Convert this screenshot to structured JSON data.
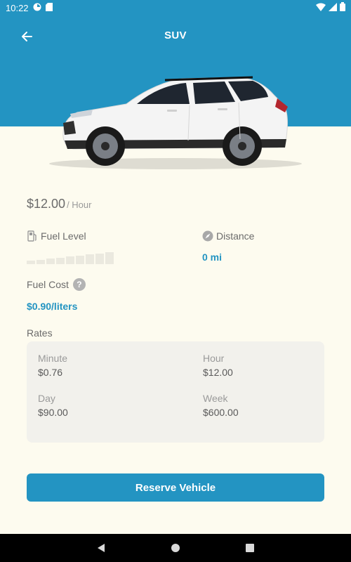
{
  "status_bar": {
    "time": "10:22"
  },
  "header": {
    "title": "SUV"
  },
  "pricing": {
    "price": "$12.00",
    "unit": "/ Hour"
  },
  "fuel": {
    "label": "Fuel Level",
    "level_fraction": 0.0
  },
  "distance": {
    "label": "Distance",
    "value": "0 mi"
  },
  "fuel_cost": {
    "label": "Fuel Cost",
    "value": "$0.90/liters"
  },
  "rates": {
    "title": "Rates",
    "items": [
      {
        "label": "Minute",
        "value": "$0.76"
      },
      {
        "label": "Hour",
        "value": "$12.00"
      },
      {
        "label": "Day",
        "value": "$90.00"
      },
      {
        "label": "Week",
        "value": "$600.00"
      }
    ]
  },
  "actions": {
    "reserve_label": "Reserve Vehicle"
  },
  "colors": {
    "accent": "#2394c2",
    "background": "#fdfbef",
    "card": "#f2f1ec"
  }
}
